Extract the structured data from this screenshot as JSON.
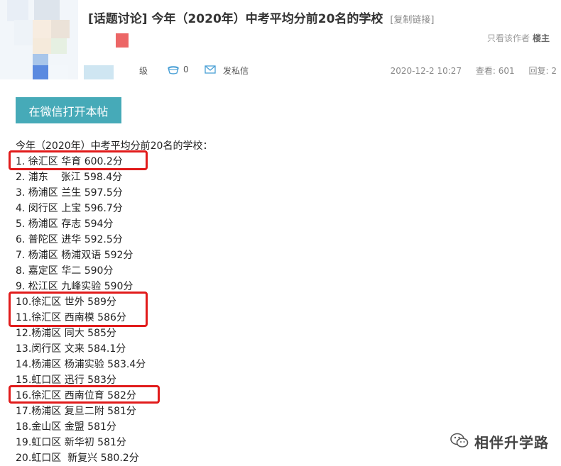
{
  "post": {
    "title": "[话题讨论] 今年（2020年）中考平均分前20名的学校",
    "copy_link": "[复制链接]",
    "only_author_text": "只看该作者",
    "louzhu": "楼主"
  },
  "meta": {
    "level": "级",
    "coin_count": "0",
    "message_label": "发私信",
    "date": "2020-12-2 10:27",
    "views_label": "查看: 601",
    "replies_label": "回复: 2"
  },
  "wechat_button": "在微信打开本帖",
  "content": {
    "intro": "今年（2020年）中考平均分前20名的学校：",
    "schools": [
      "1. 徐汇区 华育 600.2分",
      "2. 浦东    张江 598.4分",
      "3. 杨浦区 兰生 597.5分",
      "4. 闵行区 上宝 596.7分",
      "5. 杨浦区 存志 594分",
      "6. 普陀区 进华 592.5分",
      "7. 杨浦区 杨浦双语 592分",
      "8. 嘉定区 华二 590分",
      "9. 松江区 九峰实验 590分",
      "10.徐汇区 世外 589分",
      "11.徐汇区 西南模 586分",
      "12.杨浦区 同大 585分",
      "13.闵行区 文来 584.1分",
      "14.杨浦区 杨浦实验 583.4分",
      "15.虹口区 迅行 583分",
      "16.徐汇区 西南位育 582分",
      "17.杨浦区 复旦二附 581分",
      "18.金山区 金盟 581分",
      "19.虹口区 新华初 581分",
      "20.虹口区  新复兴 580.2分"
    ]
  },
  "watermark": "相伴升学路",
  "colors": {
    "button_bg": "#46aab8",
    "highlight_box": "#e11b1b",
    "copy_link": "#888888"
  }
}
